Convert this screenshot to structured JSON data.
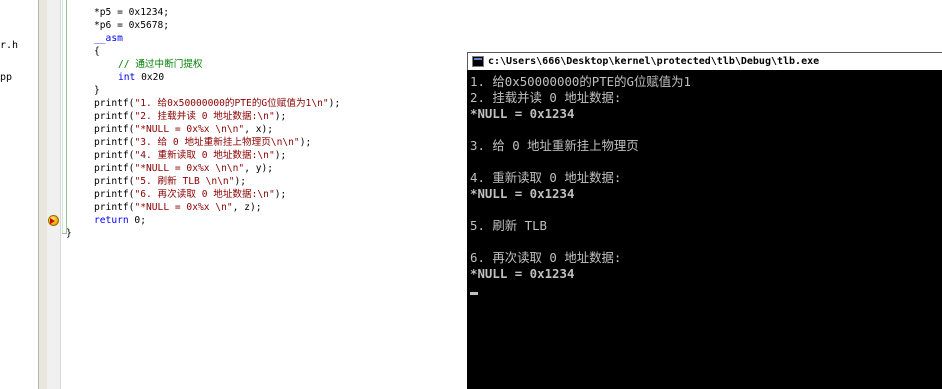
{
  "file_tree": {
    "items": [
      "r.h",
      "pp"
    ]
  },
  "code": {
    "lines": [
      {
        "parts": [
          {
            "t": "*p5 = 0x1234;",
            "c": ""
          }
        ]
      },
      {
        "parts": [
          {
            "t": "*p6 = 0x5678;",
            "c": ""
          }
        ]
      },
      {
        "parts": [
          {
            "t": "__asm",
            "c": "kw"
          }
        ]
      },
      {
        "parts": [
          {
            "t": "{",
            "c": ""
          }
        ]
      },
      {
        "parts": [
          {
            "t": "// 通过中断门提权",
            "c": "cmt"
          }
        ]
      },
      {
        "parts": [
          {
            "t": "int",
            "c": "kw"
          },
          {
            "t": " 0x20",
            "c": ""
          }
        ]
      },
      {
        "parts": [
          {
            "t": "}",
            "c": ""
          }
        ]
      },
      {
        "parts": [
          {
            "t": "printf(",
            "c": ""
          },
          {
            "t": "\"1. 给0x50000000的PTE的G位赋值为1\\n\"",
            "c": "str"
          },
          {
            "t": ");",
            "c": ""
          }
        ]
      },
      {
        "parts": [
          {
            "t": "printf(",
            "c": ""
          },
          {
            "t": "\"2. 挂载并读 0 地址数据:\\n\"",
            "c": "str"
          },
          {
            "t": ");",
            "c": ""
          }
        ]
      },
      {
        "parts": [
          {
            "t": "printf(",
            "c": ""
          },
          {
            "t": "\"*NULL = 0x%x \\n\\n\"",
            "c": "str"
          },
          {
            "t": ", x);",
            "c": ""
          }
        ]
      },
      {
        "parts": [
          {
            "t": "printf(",
            "c": ""
          },
          {
            "t": "\"3. 给 0 地址重新挂上物理页\\n\\n\"",
            "c": "str"
          },
          {
            "t": ");",
            "c": ""
          }
        ]
      },
      {
        "parts": [
          {
            "t": "printf(",
            "c": ""
          },
          {
            "t": "\"4. 重新读取 0 地址数据:\\n\"",
            "c": "str"
          },
          {
            "t": ");",
            "c": ""
          }
        ]
      },
      {
        "parts": [
          {
            "t": "printf(",
            "c": ""
          },
          {
            "t": "\"*NULL = 0x%x \\n\\n\"",
            "c": "str"
          },
          {
            "t": ", y);",
            "c": ""
          }
        ]
      },
      {
        "parts": [
          {
            "t": "printf(",
            "c": ""
          },
          {
            "t": "\"5. 刷新 TLB \\n\\n\"",
            "c": "str"
          },
          {
            "t": ");",
            "c": ""
          }
        ]
      },
      {
        "parts": [
          {
            "t": "printf(",
            "c": ""
          },
          {
            "t": "\"6. 再次读取 0 地址数据:\\n\"",
            "c": "str"
          },
          {
            "t": ");",
            "c": ""
          }
        ]
      },
      {
        "parts": [
          {
            "t": "printf(",
            "c": ""
          },
          {
            "t": "\"*NULL = 0x%x \\n\"",
            "c": "str"
          },
          {
            "t": ", z);",
            "c": ""
          }
        ]
      },
      {
        "parts": [
          {
            "t": "return",
            "c": "kw"
          },
          {
            "t": " 0;",
            "c": ""
          }
        ]
      },
      {
        "parts": [
          {
            "t": "}",
            "c": ""
          }
        ]
      }
    ]
  },
  "console": {
    "title": "c:\\Users\\666\\Desktop\\kernel\\protected\\tlb\\Debug\\tlb.exe",
    "lines": [
      {
        "text": "1. 给0x50000000的PTE的G位赋值为1",
        "bold": false
      },
      {
        "text": "2. 挂载并读 0 地址数据:",
        "bold": false
      },
      {
        "text": "*NULL = 0x1234",
        "bold": true
      },
      {
        "text": "",
        "bold": false
      },
      {
        "text": "3. 给 0 地址重新挂上物理页",
        "bold": false
      },
      {
        "text": "",
        "bold": false
      },
      {
        "text": "4. 重新读取 0 地址数据:",
        "bold": false
      },
      {
        "text": "*NULL = 0x1234",
        "bold": true
      },
      {
        "text": "",
        "bold": false
      },
      {
        "text": "5. 刷新 TLB",
        "bold": false
      },
      {
        "text": "",
        "bold": false
      },
      {
        "text": "6. 再次读取 0 地址数据:",
        "bold": false
      },
      {
        "text": "*NULL = 0x1234",
        "bold": true
      }
    ]
  },
  "colors": {
    "keyword": "#0000ff",
    "string": "#8b0000",
    "comment": "#008000",
    "console_bg": "#000000",
    "console_fg": "#c0c0c0"
  }
}
